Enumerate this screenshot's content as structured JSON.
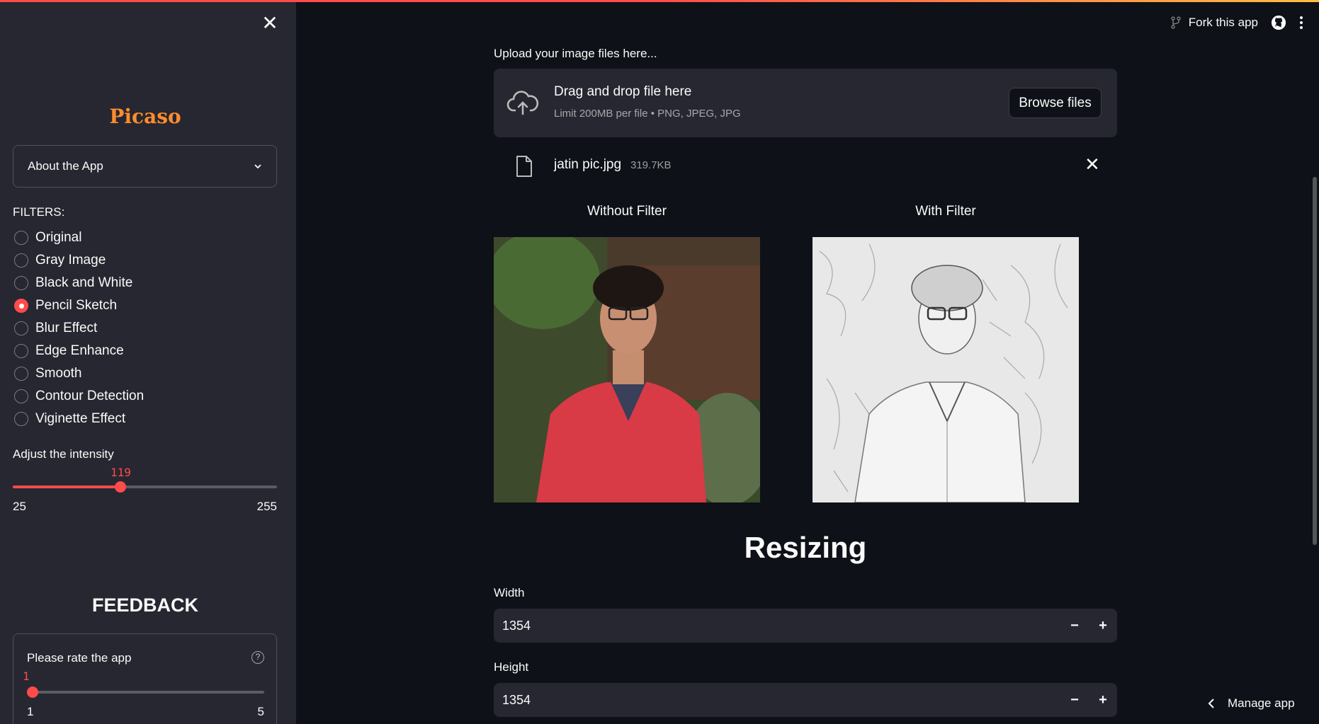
{
  "sidebar": {
    "close_glyph": "✕",
    "title": "Picaso",
    "expander_label": "About the App",
    "filters_label": "FILTERS:",
    "filters": [
      {
        "label": "Original",
        "checked": false
      },
      {
        "label": "Gray Image",
        "checked": false
      },
      {
        "label": "Black and White",
        "checked": false
      },
      {
        "label": "Pencil Sketch",
        "checked": true
      },
      {
        "label": "Blur Effect",
        "checked": false
      },
      {
        "label": "Edge Enhance",
        "checked": false
      },
      {
        "label": "Smooth",
        "checked": false
      },
      {
        "label": "Contour Detection",
        "checked": false
      },
      {
        "label": "Viginette Effect",
        "checked": false
      }
    ],
    "intensity": {
      "label": "Adjust the intensity",
      "value": "119",
      "min": "25",
      "max": "255"
    },
    "feedback": {
      "title": "FEEDBACK",
      "rate_label": "Please rate the app",
      "help_glyph": "?",
      "value": "1",
      "min": "1",
      "max": "5"
    }
  },
  "toolbar": {
    "fork_label": "Fork this app",
    "icons": [
      "fork-icon",
      "github-icon",
      "kebab-menu-icon"
    ]
  },
  "main": {
    "upload_label": "Upload your image files here...",
    "dropzone_title": "Drag and drop file here",
    "dropzone_subtitle": "Limit 200MB per file • PNG, JPEG, JPG",
    "browse_label": "Browse files",
    "file": {
      "name": "jatin pic.jpg",
      "size": "319.7KB",
      "remove_glyph": "✕"
    },
    "col_left_title": "Without Filter",
    "col_right_title": "With Filter",
    "section_title": "Resizing",
    "width": {
      "label": "Width",
      "value": "1354"
    },
    "height": {
      "label": "Height",
      "value": "1354"
    },
    "minus_glyph": "−",
    "plus_glyph": "+"
  },
  "manage_app_label": "Manage app",
  "colors": {
    "accent": "#ff4b4b",
    "title": "#ff8c2e",
    "background": "#0e1117",
    "sidebar": "#262730"
  }
}
